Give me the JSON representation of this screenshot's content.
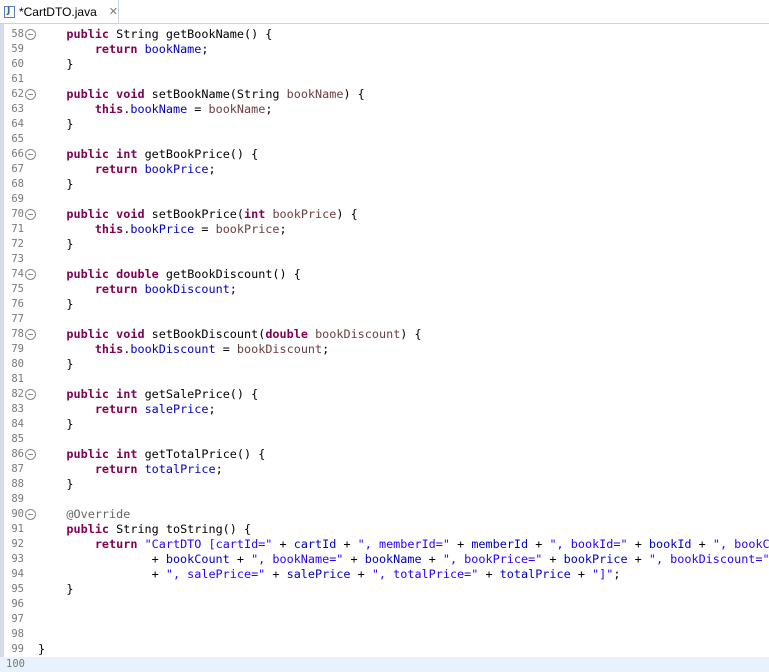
{
  "tab": {
    "title": "*CartDTO.java",
    "close": "✕",
    "icon": "java-file-icon"
  },
  "colors": {
    "keyword": "#7f0055",
    "field": "#0000c0",
    "param": "#6a3e3e",
    "string": "#2a00ff",
    "annotation": "#646464",
    "line_number": "#787878",
    "current_line": "#e8f2fe"
  },
  "editor": {
    "current_line": 100,
    "lines": [
      {
        "n": "58",
        "fold": true,
        "tokens": [
          [
            "t",
            "    "
          ],
          [
            "kw",
            "public"
          ],
          [
            "t",
            " String getBookName() {"
          ]
        ]
      },
      {
        "n": "59",
        "tokens": [
          [
            "t",
            "        "
          ],
          [
            "kw",
            "return"
          ],
          [
            "t",
            " "
          ],
          [
            "fd",
            "bookName"
          ],
          [
            "t",
            ";"
          ]
        ]
      },
      {
        "n": "60",
        "tokens": [
          [
            "t",
            "    }"
          ]
        ]
      },
      {
        "n": "61",
        "tokens": []
      },
      {
        "n": "62",
        "fold": true,
        "tokens": [
          [
            "t",
            "    "
          ],
          [
            "kw",
            "public"
          ],
          [
            "t",
            " "
          ],
          [
            "kw",
            "void"
          ],
          [
            "t",
            " setBookName(String "
          ],
          [
            "pm",
            "bookName"
          ],
          [
            "t",
            ") {"
          ]
        ]
      },
      {
        "n": "63",
        "tokens": [
          [
            "t",
            "        "
          ],
          [
            "kw",
            "this"
          ],
          [
            "t",
            "."
          ],
          [
            "fd",
            "bookName"
          ],
          [
            "t",
            " = "
          ],
          [
            "pm",
            "bookName"
          ],
          [
            "t",
            ";"
          ]
        ]
      },
      {
        "n": "64",
        "tokens": [
          [
            "t",
            "    }"
          ]
        ]
      },
      {
        "n": "65",
        "tokens": []
      },
      {
        "n": "66",
        "fold": true,
        "tokens": [
          [
            "t",
            "    "
          ],
          [
            "kw",
            "public"
          ],
          [
            "t",
            " "
          ],
          [
            "kw",
            "int"
          ],
          [
            "t",
            " getBookPrice() {"
          ]
        ]
      },
      {
        "n": "67",
        "tokens": [
          [
            "t",
            "        "
          ],
          [
            "kw",
            "return"
          ],
          [
            "t",
            " "
          ],
          [
            "fd",
            "bookPrice"
          ],
          [
            "t",
            ";"
          ]
        ]
      },
      {
        "n": "68",
        "tokens": [
          [
            "t",
            "    }"
          ]
        ]
      },
      {
        "n": "69",
        "tokens": []
      },
      {
        "n": "70",
        "fold": true,
        "tokens": [
          [
            "t",
            "    "
          ],
          [
            "kw",
            "public"
          ],
          [
            "t",
            " "
          ],
          [
            "kw",
            "void"
          ],
          [
            "t",
            " setBookPrice("
          ],
          [
            "kw",
            "int"
          ],
          [
            "t",
            " "
          ],
          [
            "pm",
            "bookPrice"
          ],
          [
            "t",
            ") {"
          ]
        ]
      },
      {
        "n": "71",
        "tokens": [
          [
            "t",
            "        "
          ],
          [
            "kw",
            "this"
          ],
          [
            "t",
            "."
          ],
          [
            "fd",
            "bookPrice"
          ],
          [
            "t",
            " = "
          ],
          [
            "pm",
            "bookPrice"
          ],
          [
            "t",
            ";"
          ]
        ]
      },
      {
        "n": "72",
        "tokens": [
          [
            "t",
            "    }"
          ]
        ]
      },
      {
        "n": "73",
        "tokens": []
      },
      {
        "n": "74",
        "fold": true,
        "tokens": [
          [
            "t",
            "    "
          ],
          [
            "kw",
            "public"
          ],
          [
            "t",
            " "
          ],
          [
            "kw",
            "double"
          ],
          [
            "t",
            " getBookDiscount() {"
          ]
        ]
      },
      {
        "n": "75",
        "tokens": [
          [
            "t",
            "        "
          ],
          [
            "kw",
            "return"
          ],
          [
            "t",
            " "
          ],
          [
            "fd",
            "bookDiscount"
          ],
          [
            "t",
            ";"
          ]
        ]
      },
      {
        "n": "76",
        "tokens": [
          [
            "t",
            "    }"
          ]
        ]
      },
      {
        "n": "77",
        "tokens": []
      },
      {
        "n": "78",
        "fold": true,
        "tokens": [
          [
            "t",
            "    "
          ],
          [
            "kw",
            "public"
          ],
          [
            "t",
            " "
          ],
          [
            "kw",
            "void"
          ],
          [
            "t",
            " setBookDiscount("
          ],
          [
            "kw",
            "double"
          ],
          [
            "t",
            " "
          ],
          [
            "pm",
            "bookDiscount"
          ],
          [
            "t",
            ") {"
          ]
        ]
      },
      {
        "n": "79",
        "tokens": [
          [
            "t",
            "        "
          ],
          [
            "kw",
            "this"
          ],
          [
            "t",
            "."
          ],
          [
            "fd",
            "bookDiscount"
          ],
          [
            "t",
            " = "
          ],
          [
            "pm",
            "bookDiscount"
          ],
          [
            "t",
            ";"
          ]
        ]
      },
      {
        "n": "80",
        "tokens": [
          [
            "t",
            "    }"
          ]
        ]
      },
      {
        "n": "81",
        "tokens": []
      },
      {
        "n": "82",
        "fold": true,
        "tokens": [
          [
            "t",
            "    "
          ],
          [
            "kw",
            "public"
          ],
          [
            "t",
            " "
          ],
          [
            "kw",
            "int"
          ],
          [
            "t",
            " getSalePrice() {"
          ]
        ]
      },
      {
        "n": "83",
        "tokens": [
          [
            "t",
            "        "
          ],
          [
            "kw",
            "return"
          ],
          [
            "t",
            " "
          ],
          [
            "fd",
            "salePrice"
          ],
          [
            "t",
            ";"
          ]
        ]
      },
      {
        "n": "84",
        "tokens": [
          [
            "t",
            "    }"
          ]
        ]
      },
      {
        "n": "85",
        "tokens": []
      },
      {
        "n": "86",
        "fold": true,
        "tokens": [
          [
            "t",
            "    "
          ],
          [
            "kw",
            "public"
          ],
          [
            "t",
            " "
          ],
          [
            "kw",
            "int"
          ],
          [
            "t",
            " getTotalPrice() {"
          ]
        ]
      },
      {
        "n": "87",
        "tokens": [
          [
            "t",
            "        "
          ],
          [
            "kw",
            "return"
          ],
          [
            "t",
            " "
          ],
          [
            "fd",
            "totalPrice"
          ],
          [
            "t",
            ";"
          ]
        ]
      },
      {
        "n": "88",
        "tokens": [
          [
            "t",
            "    }"
          ]
        ]
      },
      {
        "n": "89",
        "tokens": []
      },
      {
        "n": "90",
        "fold": true,
        "tokens": [
          [
            "t",
            "    "
          ],
          [
            "an",
            "@Override"
          ]
        ]
      },
      {
        "n": "91",
        "tokens": [
          [
            "t",
            "    "
          ],
          [
            "kw",
            "public"
          ],
          [
            "t",
            " String toString() {"
          ]
        ]
      },
      {
        "n": "92",
        "tokens": [
          [
            "t",
            "        "
          ],
          [
            "kw",
            "return"
          ],
          [
            "t",
            " "
          ],
          [
            "st",
            "\"CartDTO [cartId=\""
          ],
          [
            "t",
            " + "
          ],
          [
            "fd",
            "cartId"
          ],
          [
            "t",
            " + "
          ],
          [
            "st",
            "\", memberId=\""
          ],
          [
            "t",
            " + "
          ],
          [
            "fd",
            "memberId"
          ],
          [
            "t",
            " + "
          ],
          [
            "st",
            "\", bookId=\""
          ],
          [
            "t",
            " + "
          ],
          [
            "fd",
            "bookId"
          ],
          [
            "t",
            " + "
          ],
          [
            "st",
            "\", bookCou"
          ]
        ]
      },
      {
        "n": "93",
        "tokens": [
          [
            "t",
            "                + "
          ],
          [
            "fd",
            "bookCount"
          ],
          [
            "t",
            " + "
          ],
          [
            "st",
            "\", bookName=\""
          ],
          [
            "t",
            " + "
          ],
          [
            "fd",
            "bookName"
          ],
          [
            "t",
            " + "
          ],
          [
            "st",
            "\", bookPrice=\""
          ],
          [
            "t",
            " + "
          ],
          [
            "fd",
            "bookPrice"
          ],
          [
            "t",
            " + "
          ],
          [
            "st",
            "\", bookDiscount=\""
          ],
          [
            "t",
            " +"
          ]
        ]
      },
      {
        "n": "94",
        "tokens": [
          [
            "t",
            "                + "
          ],
          [
            "st",
            "\", salePrice=\""
          ],
          [
            "t",
            " + "
          ],
          [
            "fd",
            "salePrice"
          ],
          [
            "t",
            " + "
          ],
          [
            "st",
            "\", totalPrice=\""
          ],
          [
            "t",
            " + "
          ],
          [
            "fd",
            "totalPrice"
          ],
          [
            "t",
            " + "
          ],
          [
            "st",
            "\"]\""
          ],
          [
            "t",
            ";"
          ]
        ]
      },
      {
        "n": "95",
        "tokens": [
          [
            "t",
            "    }"
          ]
        ]
      },
      {
        "n": "96",
        "tokens": []
      },
      {
        "n": "97",
        "tokens": []
      },
      {
        "n": "98",
        "tokens": []
      },
      {
        "n": "99",
        "tokens": [
          [
            "t",
            "}"
          ]
        ]
      },
      {
        "n": "100",
        "tokens": []
      }
    ]
  }
}
